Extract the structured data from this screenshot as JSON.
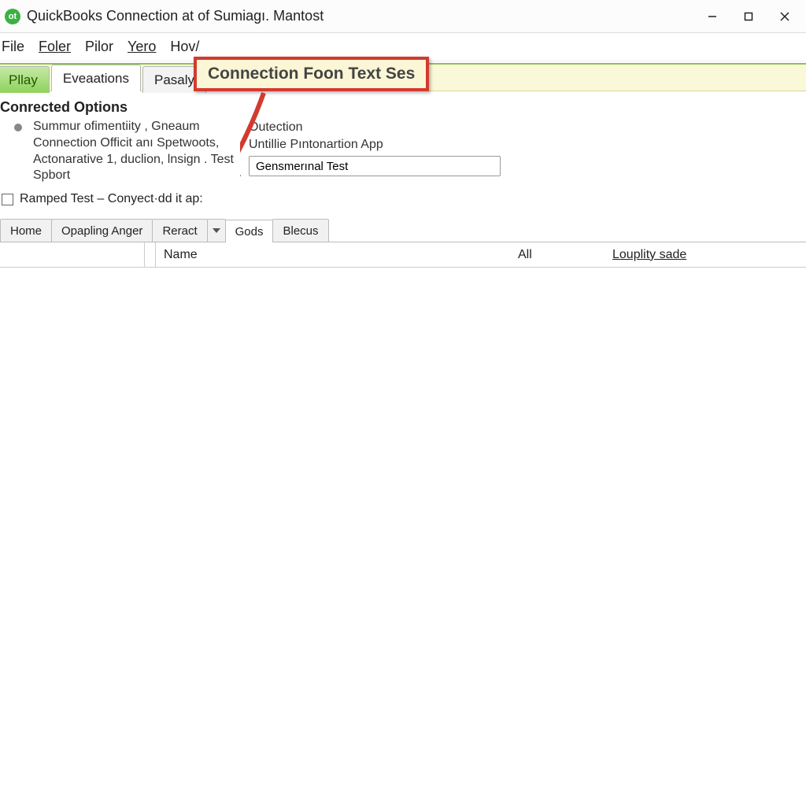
{
  "window": {
    "title": "QuickBooks Connection at of Sumiagı. Mantost"
  },
  "menu": {
    "items": [
      "File",
      "Foler",
      "Pilor",
      "Yero",
      "Hov/"
    ]
  },
  "main_tabs": {
    "play": "Pllay",
    "evaluations": "Eveaations",
    "pasaly": "Pasaly"
  },
  "callout": {
    "text": "Connection Foon Text Ses"
  },
  "section": {
    "title": "Conrected Options",
    "left_text": "Summur ofimentiity , Gneaum Connection Officit anı Spetwoots, Actonarative 1, duclion, lnsign . Test Spbort",
    "right_line1": "Outection",
    "right_line2": "Untillie Pıntonartion App",
    "input_value": "Gensmerınal Test"
  },
  "checkbox": {
    "label": "Ramped Test – Conyect·dd it ap:"
  },
  "sub_tabs": {
    "home": "Home",
    "opapling": "Opapling Anger",
    "react": "Rerаct",
    "gods": "Gods",
    "blecus": "Blecus"
  },
  "grid": {
    "col_name": "Name",
    "col_all": "All",
    "col_locality": "Louplity sade"
  }
}
